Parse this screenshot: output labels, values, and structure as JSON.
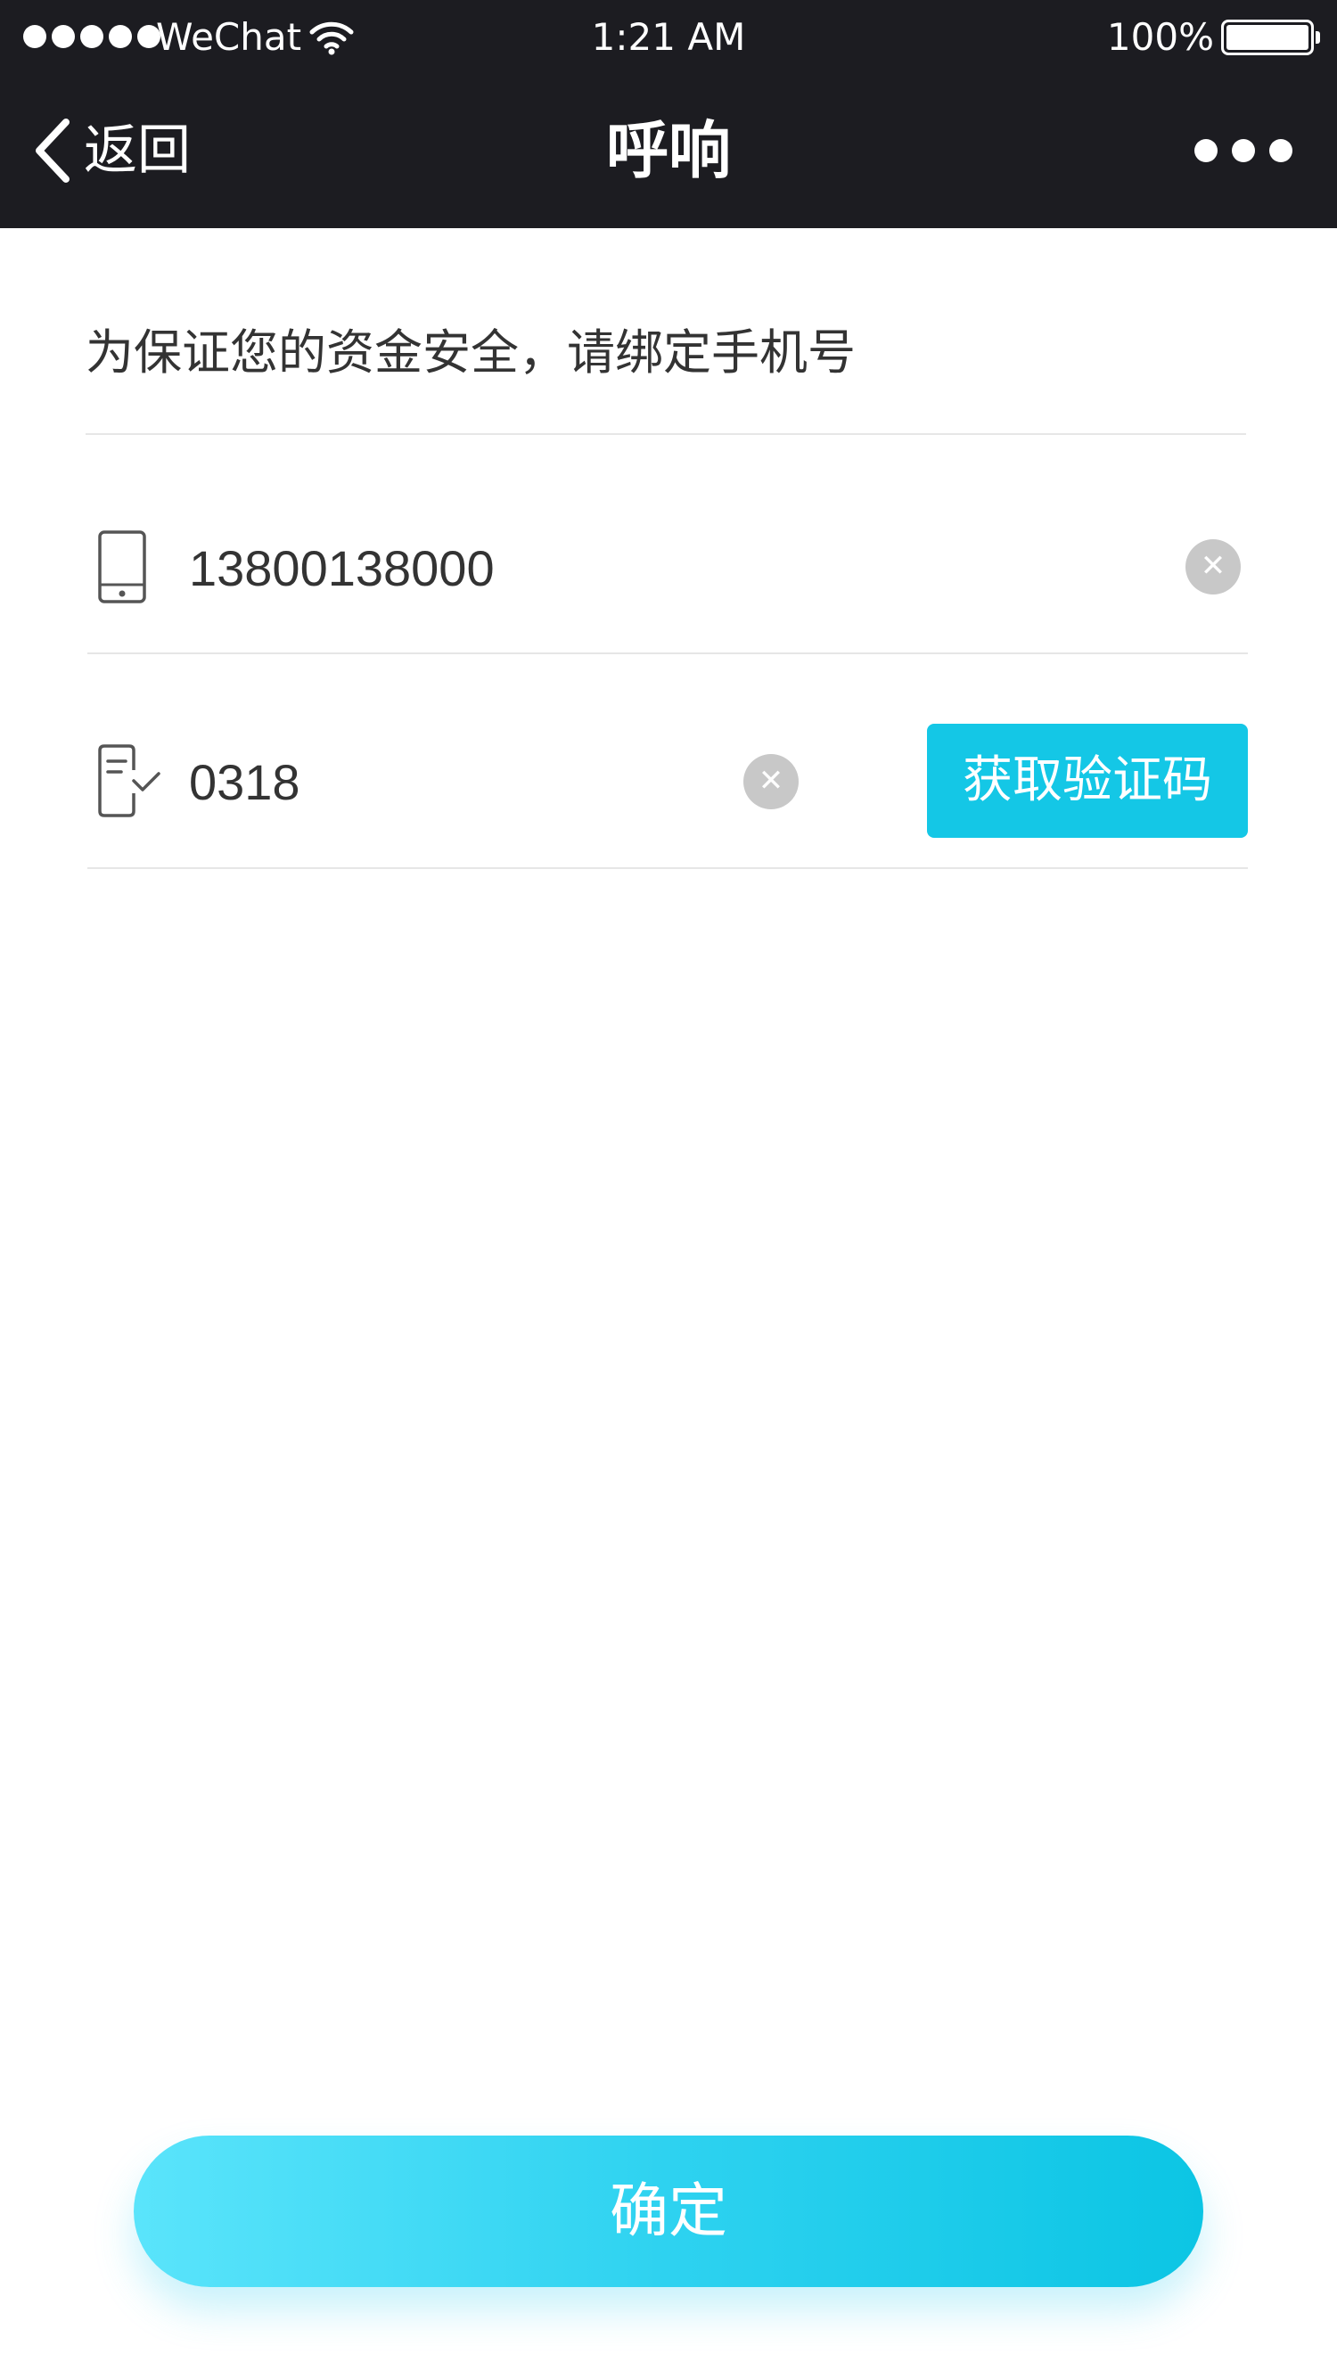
{
  "status_bar": {
    "carrier": "WeChat",
    "time": "1:21 AM",
    "battery_percent": "100%",
    "battery_level": 1.0,
    "signal_dots": 5,
    "wifi_icon": "wifi-icon"
  },
  "nav": {
    "back_label": "返回",
    "title": "呼响",
    "more_icon": "more-dots-icon"
  },
  "form": {
    "hint": "为保证您的资金安全，请绑定手机号",
    "phone": {
      "icon": "phone-icon",
      "value": "13800138000",
      "clear_icon": "clear-icon"
    },
    "code": {
      "icon": "verify-code-icon",
      "value": "0318",
      "clear_icon": "clear-icon"
    },
    "get_code_label": "获取验证码"
  },
  "confirm_label": "确定",
  "colors": {
    "top_bar": "#1c1c21",
    "accent": "#14c7e6",
    "confirm_gradient_start": "#5ae4fb",
    "confirm_gradient_end": "#0cc5e4",
    "clear_button": "#c8c8c8",
    "divider": "#e6e6e6"
  }
}
